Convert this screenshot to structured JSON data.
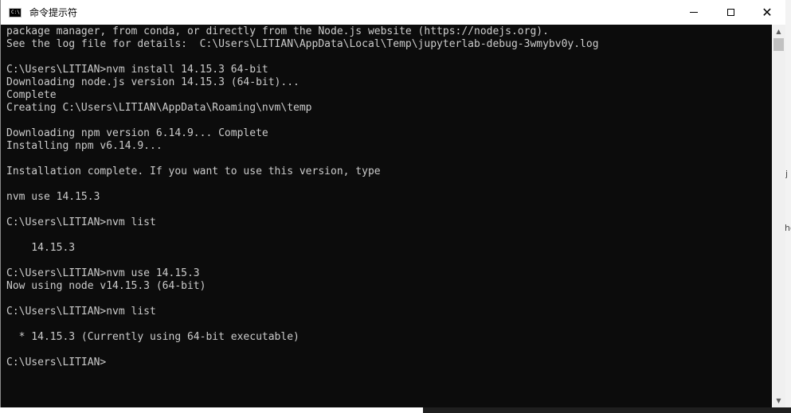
{
  "window": {
    "title": "命令提示符",
    "icon": "console-app-icon",
    "icon_glyph": "C:\\"
  },
  "console": {
    "lines": [
      "package manager, from conda, or directly from the Node.js website (https://nodejs.org).",
      "See the log file for details:  C:\\Users\\LITIAN\\AppData\\Local\\Temp\\jupyterlab-debug-3wmybv0y.log",
      "",
      "C:\\Users\\LITIAN>nvm install 14.15.3 64-bit",
      "Downloading node.js version 14.15.3 (64-bit)...",
      "Complete",
      "Creating C:\\Users\\LITIAN\\AppData\\Roaming\\nvm\\temp",
      "",
      "Downloading npm version 6.14.9... Complete",
      "Installing npm v6.14.9...",
      "",
      "Installation complete. If you want to use this version, type",
      "",
      "nvm use 14.15.3",
      "",
      "C:\\Users\\LITIAN>nvm list",
      "",
      "    14.15.3",
      "",
      "C:\\Users\\LITIAN>nvm use 14.15.3",
      "Now using node v14.15.3 (64-bit)",
      "",
      "C:\\Users\\LITIAN>nvm list",
      "",
      "  * 14.15.3 (Currently using 64-bit executable)",
      "",
      "C:\\Users\\LITIAN>"
    ]
  },
  "background": {
    "right_text_1": "j",
    "right_text_2": "ho"
  },
  "colors": {
    "console_bg": "#0c0c0c",
    "console_text": "#cccccc",
    "titlebar_bg": "#ffffff",
    "scrollbar_bg": "#f0f0f0",
    "background_accent": "#2f6fb3"
  }
}
